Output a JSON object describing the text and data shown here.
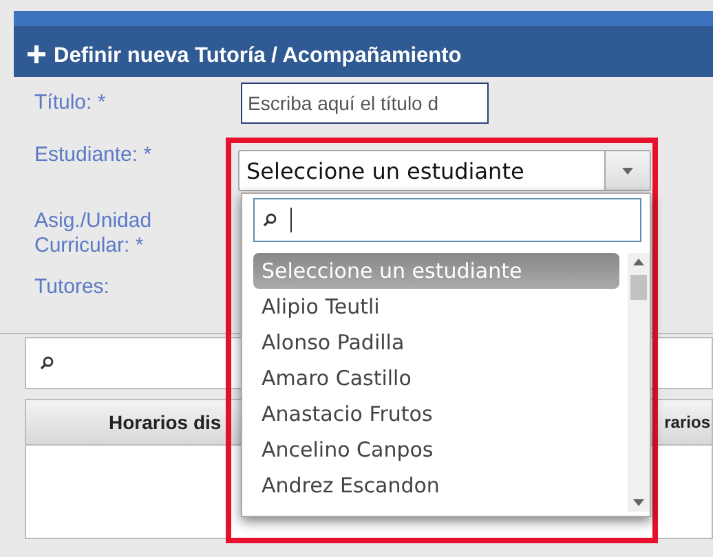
{
  "panel": {
    "title": "Definir nueva Tutoría / Acompañamiento"
  },
  "form": {
    "fields": [
      {
        "kind": "text",
        "label": "Título: *",
        "placeholder": "Escriba aquí el título d"
      },
      {
        "kind": "select",
        "label": "Estudiante: *",
        "value": "Seleccione un estudiante"
      },
      {
        "kind": "label",
        "label": "Asig./Unidad Curricular: *"
      },
      {
        "kind": "label",
        "label": "Tutores:"
      }
    ]
  },
  "table": {
    "columns": [
      "Horarios dis",
      "rarios"
    ]
  },
  "dropdown": {
    "expanded": true,
    "items": [
      {
        "label": "Seleccione un estudiante",
        "selected": true
      },
      {
        "label": "Alipio Teutli",
        "selected": false
      },
      {
        "label": "Alonso Padilla",
        "selected": false
      },
      {
        "label": "Amaro Castillo",
        "selected": false
      },
      {
        "label": "Anastacio Frutos",
        "selected": false
      },
      {
        "label": "Ancelino Canpos",
        "selected": false
      },
      {
        "label": "Andrez Escandon",
        "selected": false
      }
    ]
  }
}
